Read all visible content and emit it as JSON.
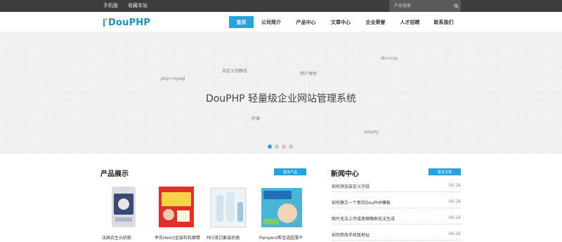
{
  "topbar": {
    "links": [
      "手机版",
      "收藏本站"
    ],
    "search": {
      "placeholder": "产品搜索"
    }
  },
  "header": {
    "logo_text": "DouPHP",
    "nav": [
      {
        "label": "首页",
        "active": true
      },
      {
        "label": "公司简介",
        "active": false
      },
      {
        "label": "产品中心",
        "active": false
      },
      {
        "label": "文章中心",
        "active": false
      },
      {
        "label": "企业荣誉",
        "active": false
      },
      {
        "label": "人才招聘",
        "active": false
      },
      {
        "label": "联系我们",
        "active": false
      }
    ]
  },
  "banner": {
    "title": "DouPHP 轻量级企业网站管理系统",
    "tags": [
      "div+css",
      "自定义伪静态",
      "用户体验",
      "php+mysql",
      "开源",
      "smarty"
    ],
    "slides": 4,
    "active_slide": 0
  },
  "products": {
    "title": "产品展示",
    "more_label": "更多产品",
    "items": [
      {
        "name": "法国合生元奶粉"
      },
      {
        "name": "亨氏Heinz金装粒粒面精"
      },
      {
        "name": "PES宽口套装奶瓶"
      },
      {
        "name": "Pampers帮宝适超薄干"
      }
    ]
  },
  "news": {
    "title": "新闻中心",
    "more_label": "更多文章",
    "items": [
      {
        "title": "如何添加自定义字段",
        "date": "06-26"
      },
      {
        "title": "如何建立一个新的DouPHP模板",
        "date": "06-26"
      },
      {
        "title": "图片无法上传或者缩略图无法生成",
        "date": "06-26"
      },
      {
        "title": "如何修改手机版地址",
        "date": "06-26"
      }
    ]
  },
  "colors": {
    "accent": "#27a4e0",
    "topbar": "#3d3d3d",
    "logo": "#1a8fc8"
  }
}
